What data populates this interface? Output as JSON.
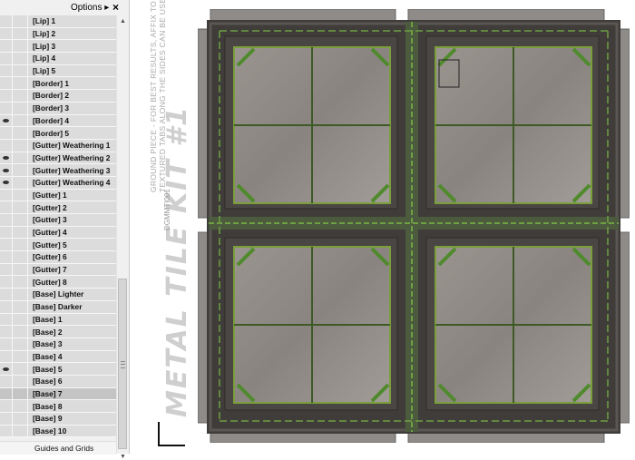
{
  "panel": {
    "options_label": "Options",
    "options_arrow": "▸",
    "close_label": "×",
    "layers": [
      {
        "label": "[Lip] 1",
        "visible": false,
        "selected": false
      },
      {
        "label": "[Lip] 2",
        "visible": false,
        "selected": false
      },
      {
        "label": "[Lip] 3",
        "visible": false,
        "selected": false
      },
      {
        "label": "[Lip] 4",
        "visible": false,
        "selected": false
      },
      {
        "label": "[Lip] 5",
        "visible": false,
        "selected": false
      },
      {
        "label": "[Border] 1",
        "visible": false,
        "selected": false
      },
      {
        "label": "[Border] 2",
        "visible": false,
        "selected": false
      },
      {
        "label": "[Border] 3",
        "visible": false,
        "selected": false
      },
      {
        "label": "[Border] 4",
        "visible": true,
        "selected": false
      },
      {
        "label": "[Border] 5",
        "visible": false,
        "selected": false
      },
      {
        "label": "[Gutter] Weathering 1",
        "visible": false,
        "selected": false
      },
      {
        "label": "[Gutter] Weathering 2",
        "visible": true,
        "selected": false
      },
      {
        "label": "[Gutter] Weathering 3",
        "visible": true,
        "selected": false
      },
      {
        "label": "[Gutter] Weathering 4",
        "visible": true,
        "selected": false
      },
      {
        "label": "[Gutter] 1",
        "visible": false,
        "selected": false
      },
      {
        "label": "[Gutter] 2",
        "visible": false,
        "selected": false
      },
      {
        "label": "[Gutter] 3",
        "visible": false,
        "selected": false
      },
      {
        "label": "[Gutter] 4",
        "visible": false,
        "selected": false
      },
      {
        "label": "[Gutter] 5",
        "visible": false,
        "selected": false
      },
      {
        "label": "[Gutter] 6",
        "visible": false,
        "selected": false
      },
      {
        "label": "[Gutter] 7",
        "visible": false,
        "selected": false
      },
      {
        "label": "[Gutter] 8",
        "visible": false,
        "selected": false
      },
      {
        "label": "[Base] Lighter",
        "visible": false,
        "selected": false
      },
      {
        "label": "[Base] Darker",
        "visible": false,
        "selected": false
      },
      {
        "label": "[Base] 1",
        "visible": false,
        "selected": false
      },
      {
        "label": "[Base] 2",
        "visible": false,
        "selected": false
      },
      {
        "label": "[Base] 3",
        "visible": false,
        "selected": false
      },
      {
        "label": "[Base] 4",
        "visible": false,
        "selected": false
      },
      {
        "label": "[Base] 5",
        "visible": true,
        "selected": false
      },
      {
        "label": "[Base] 6",
        "visible": false,
        "selected": false
      },
      {
        "label": "[Base] 7",
        "visible": false,
        "selected": true
      },
      {
        "label": "[Base] 8",
        "visible": false,
        "selected": false
      },
      {
        "label": "[Base] 9",
        "visible": false,
        "selected": false
      },
      {
        "label": "[Base] 10",
        "visible": false,
        "selected": false
      }
    ],
    "guides_label": "Guides and Grids"
  },
  "canvas": {
    "title": "METAL TILE KIT #1",
    "code": "DGMMTI001",
    "instructions_line1": "GROUND PIECE - FOR BEST RESULTS, AFFIX TO A PIECE OF FOAMCORE",
    "instructions_line2": "TEXTURED TABS ALONG THE SIDES CAN BE USED TO WRAP THE EDGES",
    "colors": {
      "panel_bg": "#f0f0f0",
      "row_bg": "#dcdcdc",
      "row_selected": "#c4c4c4",
      "metal_dark": "#3f3c3a",
      "metal_mid": "#5a5653",
      "floor": "#8a8480",
      "floor_light": "#a39e99",
      "gutter_green": "#4f8a2c",
      "moss": "#7aa35a",
      "tab_grey": "#8e8b88"
    }
  }
}
